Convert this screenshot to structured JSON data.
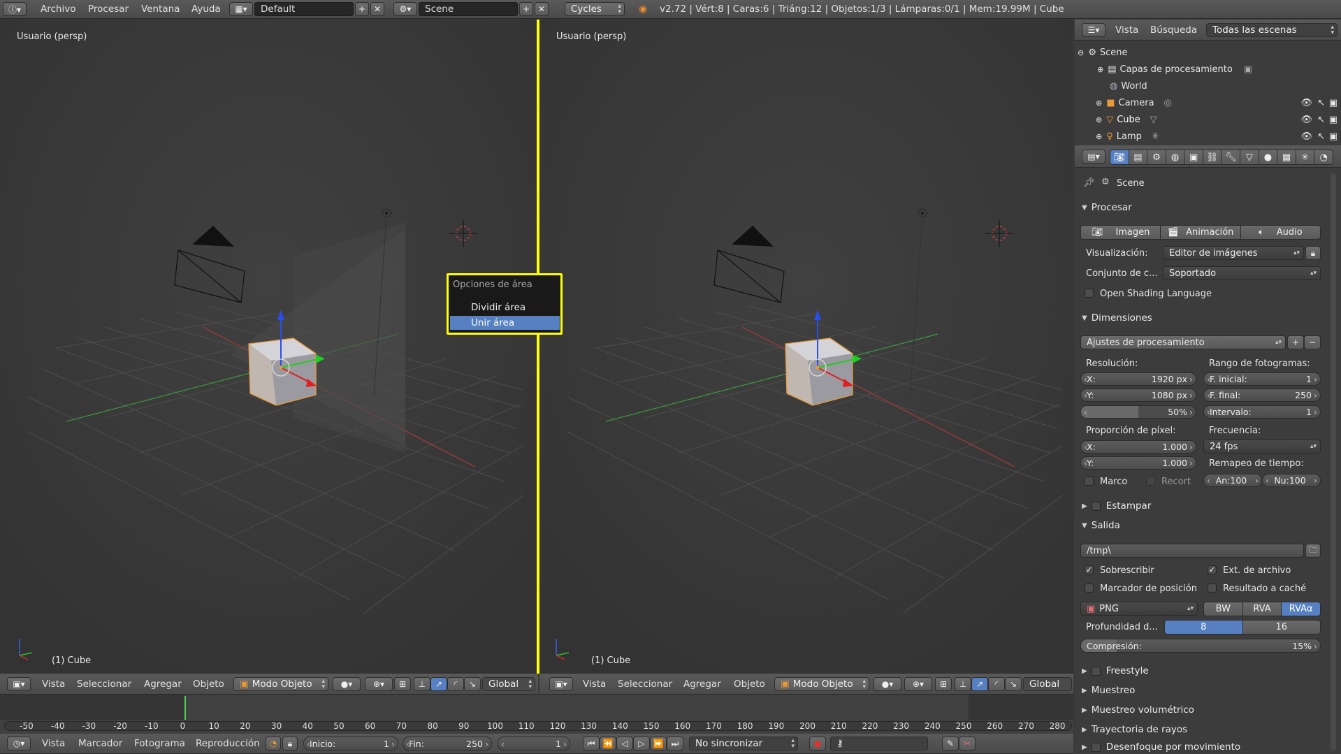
{
  "top_menu": {
    "items": [
      "Archivo",
      "Procesar",
      "Ventana",
      "Ayuda"
    ],
    "layout": "Default",
    "scene": "Scene",
    "engine": "Cycles",
    "stats": "v2.72 | Vért:8 | Caras:6 | Triáng:12 | Objetos:1/3 | Lámparas:0/1 | Mem:19.99M | Cube"
  },
  "viewport_left": {
    "label": "Usuario (persp)",
    "object": "(1) Cube"
  },
  "viewport_right": {
    "label": "Usuario (persp)",
    "object": "(1) Cube"
  },
  "context_menu": {
    "title": "Opciones de área",
    "items": [
      "Dividir área",
      "Unir área"
    ],
    "selected": "Unir área"
  },
  "view3d_header": {
    "menus": [
      "Vista",
      "Seleccionar",
      "Agregar",
      "Objeto"
    ],
    "mode": "Modo Objeto",
    "orientation": "Global"
  },
  "timeline": {
    "ticks": [
      "-50",
      "-40",
      "-30",
      "-20",
      "-10",
      "0",
      "10",
      "20",
      "30",
      "40",
      "50",
      "60",
      "70",
      "80",
      "90",
      "100",
      "110",
      "120",
      "130",
      "140",
      "150",
      "160",
      "170",
      "180",
      "190",
      "200",
      "210",
      "220",
      "230",
      "240",
      "250",
      "260",
      "270",
      "280"
    ],
    "menus": [
      "Vista",
      "Marcador",
      "Fotograma",
      "Reproducción"
    ],
    "start_label": "Inicio:",
    "start": "1",
    "end_label": "Fin:",
    "end": "250",
    "current": "1",
    "sync": "No sincronizar"
  },
  "outliner": {
    "menus": [
      "Vista",
      "Búsqueda"
    ],
    "filter": "Todas las escenas",
    "rows": [
      {
        "name": "Scene"
      },
      {
        "name": "Capas de procesamiento"
      },
      {
        "name": "World"
      },
      {
        "name": "Camera"
      },
      {
        "name": "Cube"
      },
      {
        "name": "Lamp"
      }
    ]
  },
  "properties": {
    "context": "Scene",
    "procesar": {
      "header": "Procesar",
      "buttons": [
        "Imagen",
        "Animación",
        "Audio"
      ],
      "visualizacion_label": "Visualización:",
      "visualizacion": "Editor de imágenes",
      "conjunto_label": "Conjunto de c...",
      "conjunto": "Soportado",
      "osl": "Open Shading Language"
    },
    "dimensiones": {
      "header": "Dimensiones",
      "preset": "Ajustes de procesamiento",
      "resolucion_label": "Resolución:",
      "res_x_label": "X:",
      "res_x": "1920 px",
      "res_y_label": "Y:",
      "res_y": "1080 px",
      "res_pct": "50%",
      "rango_label": "Rango de fotogramas:",
      "f_inicial_label": "F. inicial:",
      "f_inicial": "1",
      "f_final_label": "F. final:",
      "f_final": "250",
      "intervalo_label": "Intervalo:",
      "intervalo": "1",
      "proporcion_label": "Proporción de píxel:",
      "asp_x_label": "X:",
      "asp_x": "1.000",
      "asp_y_label": "Y:",
      "asp_y": "1.000",
      "frecuencia_label": "Frecuencia:",
      "fps": "24 fps",
      "remapeo_label": "Remapeo de tiempo:",
      "an": "An:100",
      "nu": "Nu:100",
      "marco": "Marco",
      "recort": "Recort"
    },
    "estampar": "Estampar",
    "salida": {
      "header": "Salida",
      "path": "/tmp\\",
      "sobrescribir": "Sobrescribir",
      "ext": "Ext. de archivo",
      "marcador": "Marcador de posición",
      "cache": "Resultado a caché",
      "format": "PNG",
      "color_modes": [
        "BW",
        "RVA",
        "RVAα"
      ],
      "depth_label": "Profundidad d...",
      "depths": [
        "8",
        "16"
      ],
      "compresion": "Compresión:",
      "compresion_val": "15%",
      "compresion_fill": 0.15
    },
    "collapsed": [
      "Freestyle",
      "Muestreo",
      "Muestreo volumétrico",
      "Trayectoria de rayos",
      "Desenfoque por movimiento"
    ]
  },
  "colors": {
    "accent": "#5680c2",
    "highlight": "#ffff00"
  }
}
